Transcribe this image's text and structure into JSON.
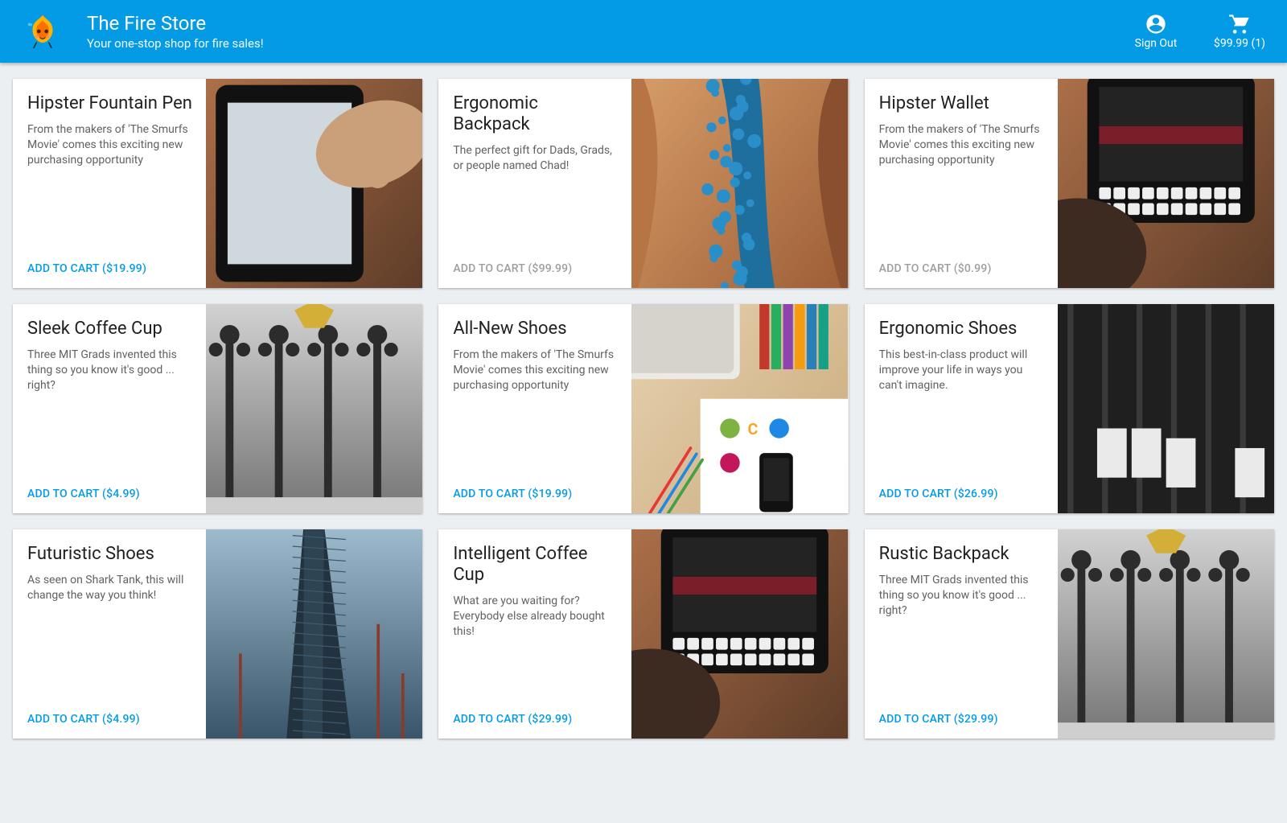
{
  "header": {
    "title": "The Fire Store",
    "subtitle": "Your one-stop shop for fire sales!",
    "signout_label": "Sign Out",
    "cart_label": "$99.99 (1)"
  },
  "colors": {
    "primary": "#039be5",
    "text": "#212121",
    "muted": "#616161",
    "disabled": "#9e9e9e",
    "bg": "#eceff1"
  },
  "products": [
    {
      "title": "Hipster Fountain Pen",
      "description": "From the makers of 'The Smurfs Movie' comes this exciting new purchasing opportunity",
      "cta": "ADD TO CART ($19.99)",
      "cta_enabled": true,
      "image": "tablet-finger"
    },
    {
      "title": "Ergonomic Backpack",
      "description": "The perfect gift for Dads, Grads, or people named Chad!",
      "cta": "ADD TO CART ($99.99)",
      "cta_enabled": false,
      "image": "canyon-blue"
    },
    {
      "title": "Hipster Wallet",
      "description": "From the makers of 'The Smurfs Movie' comes this exciting new purchasing opportunity",
      "cta": "ADD TO CART ($0.99)",
      "cta_enabled": false,
      "image": "tablet-keyboard"
    },
    {
      "title": "Sleek Coffee Cup",
      "description": "Three MIT Grads invented this thing so you know it's good ... right?",
      "cta": "ADD TO CART ($4.99)",
      "cta_enabled": true,
      "image": "paris-lamps"
    },
    {
      "title": "All-New Shoes",
      "description": "From the makers of 'The Smurfs Movie' comes this exciting new purchasing opportunity",
      "cta": "ADD TO CART ($19.99)",
      "cta_enabled": true,
      "image": "desk-flatlay"
    },
    {
      "title": "Ergonomic Shoes",
      "description": "This best-in-class product will improve your life in ways you can't imagine.",
      "cta": "ADD TO CART ($26.99)",
      "cta_enabled": true,
      "image": "building-bw"
    },
    {
      "title": "Futuristic Shoes",
      "description": "As seen on Shark Tank, this will change the way you think!",
      "cta": "ADD TO CART ($4.99)",
      "cta_enabled": true,
      "image": "skyscraper"
    },
    {
      "title": "Intelligent Coffee Cup",
      "description": "What are you waiting for? Everybody else already bought this!",
      "cta": "ADD TO CART ($29.99)",
      "cta_enabled": true,
      "image": "tablet-keyboard"
    },
    {
      "title": "Rustic Backpack",
      "description": "Three MIT Grads invented this thing so you know it's good ... right?",
      "cta": "ADD TO CART ($29.99)",
      "cta_enabled": true,
      "image": "paris-lamps"
    }
  ]
}
